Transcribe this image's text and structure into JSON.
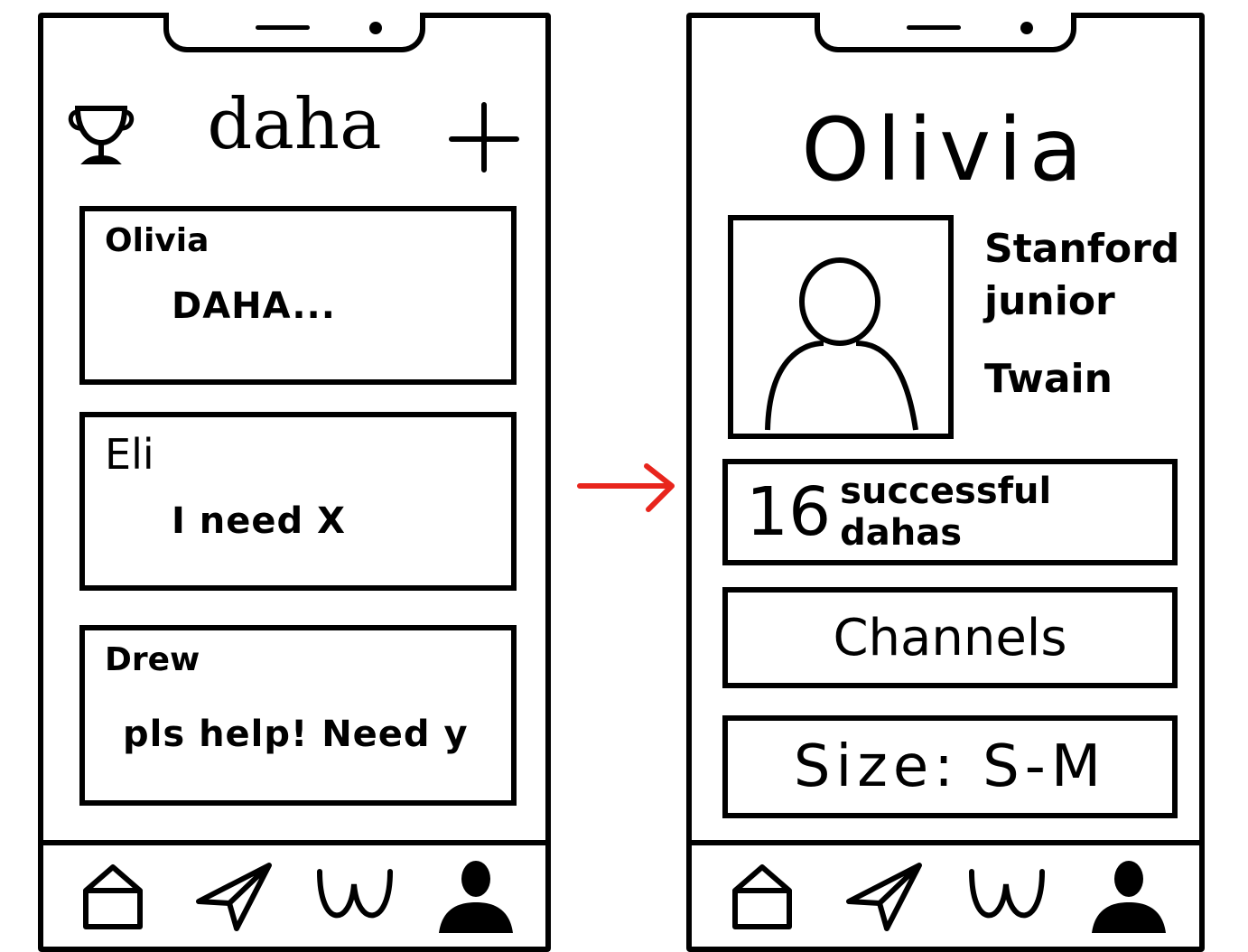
{
  "left_screen": {
    "app_title": "daha",
    "cards": [
      {
        "name": "Olivia",
        "message": "DAHA..."
      },
      {
        "name": "Eli",
        "message": "I need X"
      },
      {
        "name": "Drew",
        "message": "pls help! Need y"
      }
    ]
  },
  "right_screen": {
    "profile_name": "Olivia",
    "info": {
      "school": "Stanford",
      "year": "junior",
      "dorm": "Twain"
    },
    "stats": {
      "count": "16",
      "label": "successful dahas"
    },
    "channels_label": "Channels",
    "size_label": "Size: S-M"
  },
  "tabbar_icons": [
    "home-icon",
    "send-icon",
    "w-icon",
    "profile-icon"
  ],
  "colors": {
    "arrow": "#e8251d",
    "ink": "#000000"
  }
}
